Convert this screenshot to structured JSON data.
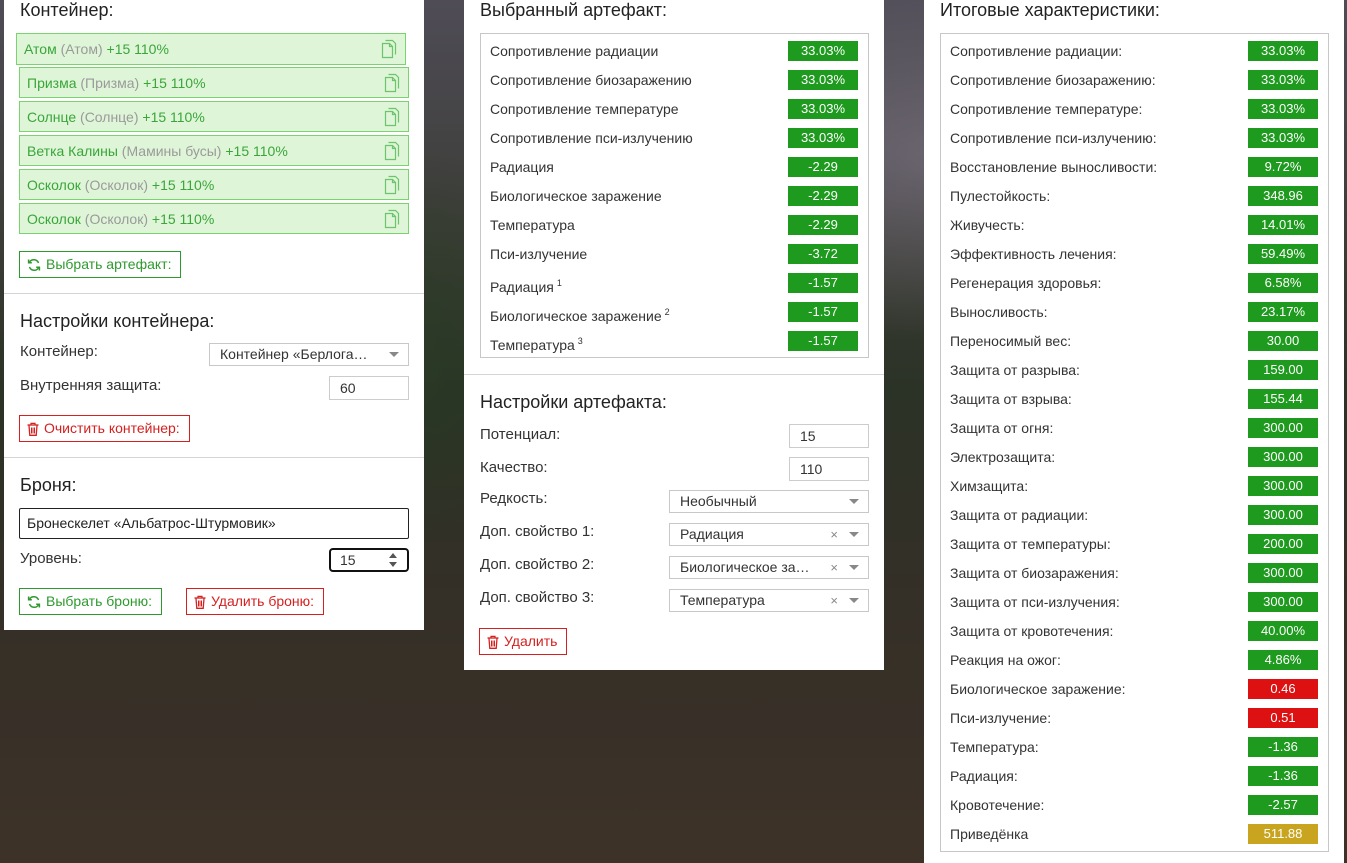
{
  "colors": {
    "accent_green": "#2e9a2e",
    "danger_red": "#d62020",
    "positive": "#1e9a1e",
    "negative": "#dd1111",
    "highlight": "#c9a41e"
  },
  "container_panel": {
    "title": "Контейнер:",
    "artifacts": [
      {
        "name": "Атом",
        "sub": "(Атом)",
        "bonus": "+15 110%"
      },
      {
        "name": "Призма",
        "sub": "(Призма)",
        "bonus": "+15 110%"
      },
      {
        "name": "Солнце",
        "sub": "(Солнце)",
        "bonus": "+15 110%"
      },
      {
        "name": "Ветка Калины",
        "sub": "(Мамины бусы)",
        "bonus": "+15 110%"
      },
      {
        "name": "Осколок",
        "sub": "(Осколок)",
        "bonus": "+15 110%"
      },
      {
        "name": "Осколок",
        "sub": "(Осколок)",
        "bonus": "+15 110%"
      }
    ],
    "copy_icon": "copy-icon",
    "select_artifact_label": "Выбрать артефакт:",
    "settings_title": "Настройки контейнера:",
    "container_label": "Контейнер:",
    "container_value": "Контейнер «Берлога…",
    "inner_protection_label": "Внутренняя защита:",
    "inner_protection_value": "60",
    "clear_container_label": "Очистить контейнер:",
    "armor_title": "Броня:",
    "armor_value": "Бронескелет «Альбатрос-Штурмовик»",
    "level_label": "Уровень:",
    "level_value": "15",
    "select_armor_label": "Выбрать броню:",
    "delete_armor_label": "Удалить броню:"
  },
  "artifact_panel": {
    "title": "Выбранный артефакт:",
    "stats": [
      {
        "label": "Сопротивление радиации",
        "sup": "",
        "value": "33.03%",
        "color": "g"
      },
      {
        "label": "Сопротивление биозаражению",
        "sup": "",
        "value": "33.03%",
        "color": "g"
      },
      {
        "label": "Сопротивление температуре",
        "sup": "",
        "value": "33.03%",
        "color": "g"
      },
      {
        "label": "Сопротивление пси-излучению",
        "sup": "",
        "value": "33.03%",
        "color": "g"
      },
      {
        "label": "Радиация",
        "sup": "",
        "value": "-2.29",
        "color": "g"
      },
      {
        "label": "Биологическое заражение",
        "sup": "",
        "value": "-2.29",
        "color": "g"
      },
      {
        "label": "Температура",
        "sup": "",
        "value": "-2.29",
        "color": "g"
      },
      {
        "label": "Пси-излучение",
        "sup": "",
        "value": "-3.72",
        "color": "g"
      },
      {
        "label": "Радиация",
        "sup": "1",
        "value": "-1.57",
        "color": "g"
      },
      {
        "label": "Биологическое заражение",
        "sup": "2",
        "value": "-1.57",
        "color": "g"
      },
      {
        "label": "Температура",
        "sup": "3",
        "value": "-1.57",
        "color": "g"
      }
    ],
    "settings_title": "Настройки артефакта:",
    "potential_label": "Потенциал:",
    "potential_value": "15",
    "quality_label": "Качество:",
    "quality_value": "110",
    "rarity_label": "Редкость:",
    "rarity_value": "Необычный",
    "extra1_label": "Доп. свойство 1:",
    "extra1_value": "Радиация",
    "extra2_label": "Доп. свойство 2:",
    "extra2_value": "Биологическое за…",
    "extra3_label": "Доп. свойство 3:",
    "extra3_value": "Температура",
    "clear_glyph": "×",
    "delete_label": "Удалить"
  },
  "totals_panel": {
    "title": "Итоговые характеристики:",
    "stats": [
      {
        "label": "Сопротивление радиации:",
        "value": "33.03%",
        "color": "g"
      },
      {
        "label": "Сопротивление биозаражению:",
        "value": "33.03%",
        "color": "g"
      },
      {
        "label": "Сопротивление температуре:",
        "value": "33.03%",
        "color": "g"
      },
      {
        "label": "Сопротивление пси-излучению:",
        "value": "33.03%",
        "color": "g"
      },
      {
        "label": "Восстановление выносливости:",
        "value": "9.72%",
        "color": "g"
      },
      {
        "label": "Пулестойкость:",
        "value": "348.96",
        "color": "g"
      },
      {
        "label": "Живучесть:",
        "value": "14.01%",
        "color": "g"
      },
      {
        "label": "Эффективность лечения:",
        "value": "59.49%",
        "color": "g"
      },
      {
        "label": "Регенерация здоровья:",
        "value": "6.58%",
        "color": "g"
      },
      {
        "label": "Выносливость:",
        "value": "23.17%",
        "color": "g"
      },
      {
        "label": "Переносимый вес:",
        "value": "30.00",
        "color": "g"
      },
      {
        "label": "Защита от разрыва:",
        "value": "159.00",
        "color": "g"
      },
      {
        "label": "Защита от взрыва:",
        "value": "155.44",
        "color": "g"
      },
      {
        "label": "Защита от огня:",
        "value": "300.00",
        "color": "g"
      },
      {
        "label": "Электрозащита:",
        "value": "300.00",
        "color": "g"
      },
      {
        "label": "Химзащита:",
        "value": "300.00",
        "color": "g"
      },
      {
        "label": "Защита от радиации:",
        "value": "300.00",
        "color": "g"
      },
      {
        "label": "Защита от температуры:",
        "value": "200.00",
        "color": "g"
      },
      {
        "label": "Защита от биозаражения:",
        "value": "300.00",
        "color": "g"
      },
      {
        "label": "Защита от пси-излучения:",
        "value": "300.00",
        "color": "g"
      },
      {
        "label": "Защита от кровотечения:",
        "value": "40.00%",
        "color": "g"
      },
      {
        "label": "Реакция на ожог:",
        "value": "4.86%",
        "color": "g"
      },
      {
        "label": "Биологическое заражение:",
        "value": "0.46",
        "color": "r"
      },
      {
        "label": "Пси-излучение:",
        "value": "0.51",
        "color": "r"
      },
      {
        "label": "Температура:",
        "value": "-1.36",
        "color": "g"
      },
      {
        "label": "Радиация:",
        "value": "-1.36",
        "color": "g"
      },
      {
        "label": "Кровотечение:",
        "value": "-2.57",
        "color": "g"
      },
      {
        "label": "Приведёнка",
        "value": "511.88",
        "color": "y"
      }
    ]
  }
}
